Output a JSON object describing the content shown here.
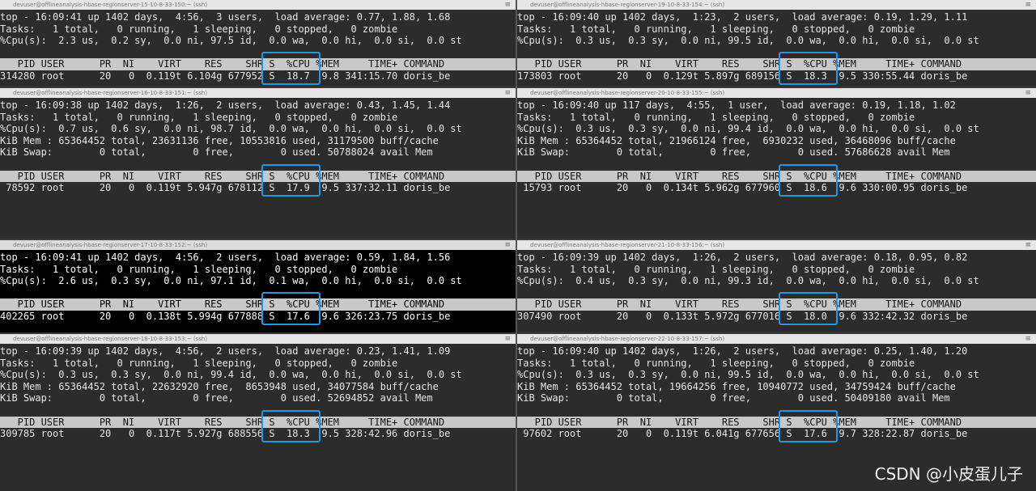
{
  "panes": [
    {
      "title": "devuser@offlineanalysis-hbase-regionserver-15-10-8-33-150:~ (ssh)",
      "lines": [
        "top - 16:09:41 up 1402 days,  4:56,  3 users,  load average: 0.77, 1.88, 1.68",
        "Tasks:   1 total,   0 running,   1 sleeping,   0 stopped,   0 zombie",
        "%Cpu(s):  2.3 us,  0.2 sy,  0.0 ni, 97.5 id,  0.0 wa,  0.0 hi,  0.0 si,  0.0 st",
        "",
        "   PID USER      PR  NI    VIRT    RES    SHR S  %CPU %MEM     TIME+ COMMAND",
        "314280 root      20   0  0.119t 6.104g 677952 S  18.7  9.8 341:15.70 doris_be"
      ]
    },
    {
      "title": "devuser@offlineanalysis-hbase-regionserver-19-10-8-33-154:~ (ssh)",
      "lines": [
        "top - 16:09:40 up 1402 days,  1:23,  2 users,  load average: 0.19, 1.29, 1.11",
        "Tasks:   1 total,   0 running,   1 sleeping,   0 stopped,   0 zombie",
        "%Cpu(s):  0.3 us,  0.3 sy,  0.0 ni, 99.5 id,  0.0 wa,  0.0 hi,  0.0 si,  0.0 st",
        "",
        "   PID USER      PR  NI    VIRT    RES    SHR S  %CPU %MEM     TIME+ COMMAND",
        "173803 root      20   0  0.129t 5.897g 689156 S  18.3  9.5 330:55.44 doris_be"
      ]
    },
    {
      "title": "devuser@offlineanalysis-hbase-regionserver-16-10-8-33-151:~ (ssh)",
      "lines": [
        "top - 16:09:38 up 1402 days,  1:26,  2 users,  load average: 0.43, 1.45, 1.44",
        "Tasks:   1 total,   0 running,   1 sleeping,   0 stopped,   0 zombie",
        "%Cpu(s):  0.7 us,  0.6 sy,  0.0 ni, 98.7 id,  0.0 wa,  0.0 hi,  0.0 si,  0.0 st",
        "KiB Mem : 65364452 total, 23631136 free, 10553816 used, 31179500 buff/cache",
        "KiB Swap:        0 total,        0 free,        0 used. 50788024 avail Mem",
        "",
        "   PID USER      PR  NI    VIRT    RES    SHR S  %CPU %MEM     TIME+ COMMAND",
        " 78592 root      20   0  0.119t 5.947g 678112 S  17.9  9.5 337:32.11 doris_be"
      ]
    },
    {
      "title": "devuser@offlineanalysis-hbase-regionserver-20-10-8-33-155:~ (ssh)",
      "lines": [
        "top - 16:09:40 up 117 days,  4:55,  1 user,  load average: 0.19, 1.18, 1.02",
        "Tasks:   1 total,   0 running,   1 sleeping,   0 stopped,   0 zombie",
        "%Cpu(s):  0.3 us,  0.3 sy,  0.0 ni, 99.4 id,  0.0 wa,  0.0 hi,  0.0 si,  0.0 st",
        "KiB Mem : 65364452 total, 21966124 free,  6930232 used, 36468096 buff/cache",
        "KiB Swap:        0 total,        0 free,        0 used. 57686628 avail Mem",
        "",
        "   PID USER      PR  NI    VIRT    RES    SHR S  %CPU %MEM     TIME+ COMMAND",
        " 15793 root      20   0  0.134t 5.962g 677960 S  18.6  9.6 330:00.95 doris_be"
      ]
    },
    {
      "title": "devuser@offlineanalysis-hbase-regionserver-17-10-8-33-152:~ (ssh)",
      "lines": [
        "top - 16:09:41 up 1402 days,  4:56,  2 users,  load average: 0.59, 1.84, 1.56",
        "Tasks:   1 total,   0 running,   1 sleeping,   0 stopped,   0 zombie",
        "%Cpu(s):  2.6 us,  0.3 sy,  0.0 ni, 97.1 id,  0.1 wa,  0.0 hi,  0.0 si,  0.0 st",
        "",
        "   PID USER      PR  NI    VIRT    RES    SHR S  %CPU %MEM     TIME+ COMMAND",
        "402265 root      20   0  0.138t 5.994g 677888 S  17.6  9.6 326:23.75 doris_be"
      ]
    },
    {
      "title": "devuser@offlineanalysis-hbase-regionserver-21-10-8-33-156:~ (ssh)",
      "lines": [
        "top - 16:09:39 up 1402 days,  1:26,  2 users,  load average: 0.18, 0.95, 0.82",
        "Tasks:   1 total,   0 running,   1 sleeping,   0 stopped,   0 zombie",
        "%Cpu(s):  0.4 us,  0.3 sy,  0.0 ni, 99.3 id,  0.0 wa,  0.0 hi,  0.0 si,  0.0 st",
        "",
        "   PID USER      PR  NI    VIRT    RES    SHR S  %CPU %MEM     TIME+ COMMAND",
        "307490 root      20   0  0.133t 5.972g 677016 S  18.0  9.6 332:42.32 doris_be"
      ]
    },
    {
      "title": "devuser@offlineanalysis-hbase-regionserver-18-10-8-33-153:~ (ssh)",
      "lines": [
        "top - 16:09:39 up 1402 days,  4:56,  2 users,  load average: 0.23, 1.41, 1.09",
        "Tasks:   1 total,   0 running,   1 sleeping,   0 stopped,   0 zombie",
        "%Cpu(s):  0.3 us,  0.3 sy,  0.0 ni, 99.4 id,  0.0 wa,  0.0 hi,  0.0 si,  0.0 st",
        "KiB Mem : 65364452 total, 22632920 free,  8653948 used, 34077584 buff/cache",
        "KiB Swap:        0 total,        0 free,        0 used. 52694852 avail Mem",
        "",
        "   PID USER      PR  NI    VIRT    RES    SHR S  %CPU %MEM     TIME+ COMMAND",
        "309785 root      20   0  0.117t 5.927g 688556 S  18.3  9.5 328:42.96 doris_be"
      ]
    },
    {
      "title": "devuser@offlineanalysis-hbase-regionserver-22-10-8-33-157:~ (ssh)",
      "lines": [
        "top - 16:09:40 up 1402 days,  1:26,  2 users,  load average: 0.25, 1.40, 1.20",
        "Tasks:   1 total,   0 running,   1 sleeping,   0 stopped,   0 zombie",
        "%Cpu(s):  0.3 us,  0.3 sy,  0.0 ni, 99.5 id,  0.0 wa,  0.0 hi,  0.0 si,  0.0 st",
        "KiB Mem : 65364452 total, 19664256 free, 10940772 used, 34759424 buff/cache",
        "KiB Swap:        0 total,        0 free,        0 used. 50409180 avail Mem",
        "",
        "   PID USER      PR  NI    VIRT    RES    SHR S  %CPU %MEM     TIME+ COMMAND",
        " 97602 root      20   0  0.119t 6.041g 677656 S  17.6  9.7 328:22.87 doris_be"
      ]
    }
  ],
  "menu_glyph": "≡",
  "watermark": "CSDN @小皮蛋儿子",
  "colors": {
    "highlight": "#1e9be8",
    "header_bar": "#c8c8c8",
    "pane_bg": "#2c2c2c"
  }
}
